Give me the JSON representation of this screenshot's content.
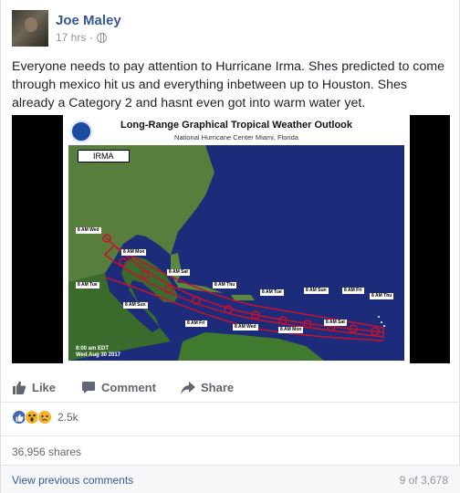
{
  "post": {
    "author": "Joe Maley",
    "time": "17 hrs",
    "separator": "·",
    "text": "Everyone needs to pay attention to Hurricane Irma. Shes predicted to come through mexico hit us and everything inbetween up to Houston. Shes already a Category 2 and hasnt even got into warm water yet."
  },
  "image": {
    "title": "Long-Range Graphical Tropical Weather Outlook",
    "subtitle": "National Hurricane Center  Miami, Florida",
    "storm_label": "IRMA",
    "timestamp_line1": "8:00 am EDT",
    "timestamp_line2": "Wed Aug 30 2017",
    "track_labels": [
      "8 AM Wed",
      "8 AM Mon",
      "8 AM Sat",
      "8 AM Thu",
      "8 AM Tue",
      "8 AM Sun",
      "8 AM Fri",
      "8 AM Thu",
      "8 AM Tue",
      "8 AM Sun",
      "8 AM Fri",
      "8 AM Wed",
      "8 AM Mon",
      "8 AM Sat"
    ]
  },
  "actions": {
    "like": "Like",
    "comment": "Comment",
    "share": "Share"
  },
  "reactions": {
    "count": "2.5k",
    "icons": [
      "like-reaction-icon",
      "wow-reaction-icon",
      "sad-reaction-icon"
    ]
  },
  "shares": "36,956 shares",
  "comments": {
    "view_previous": "View previous comments",
    "position": "9 of 3,678"
  },
  "colors": {
    "link": "#365899",
    "muted": "#90949c",
    "action": "#616770",
    "like_blue": "#4267b2",
    "track_red": "#c8102e"
  }
}
